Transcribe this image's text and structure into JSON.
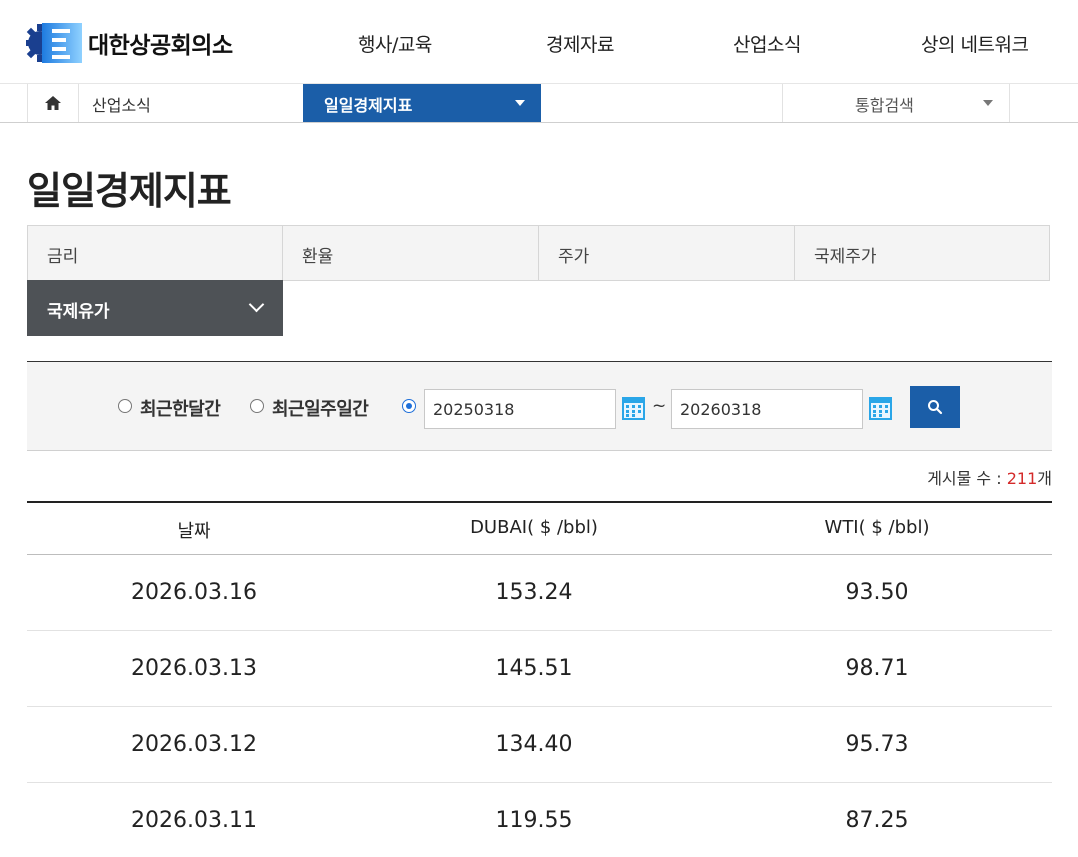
{
  "header": {
    "logo_text": "대한상공회의소",
    "nav": [
      {
        "label": "행사/교육"
      },
      {
        "label": "경제자료"
      },
      {
        "label": "산업소식"
      },
      {
        "label": "상의 네트워크"
      }
    ]
  },
  "breadcrumb": {
    "home_icon": "home-icon",
    "level1": "산업소식",
    "current": "일일경제지표",
    "search_label": "통합검색"
  },
  "page": {
    "title": "일일경제지표"
  },
  "tabs": [
    {
      "label": "금리"
    },
    {
      "label": "환율"
    },
    {
      "label": "주가"
    },
    {
      "label": "국제주가"
    },
    {
      "label": "국제유가",
      "active": true
    }
  ],
  "search": {
    "option_month": "최근한달간",
    "option_week": "최근일주일간",
    "start_date": "20250318",
    "end_date": "20260318",
    "separator": "~",
    "button_icon": "search-icon"
  },
  "count": {
    "label": "게시물 수 : ",
    "value": "211",
    "unit": "개"
  },
  "table": {
    "headers": [
      "날짜",
      "DUBAI( $ /bbl)",
      "WTI( $ /bbl)"
    ],
    "rows": [
      [
        "2026.03.16",
        "153.24",
        "93.50"
      ],
      [
        "2026.03.13",
        "145.51",
        "98.71"
      ],
      [
        "2026.03.12",
        "134.40",
        "95.73"
      ],
      [
        "2026.03.11",
        "119.55",
        "87.25"
      ]
    ]
  },
  "colors": {
    "primary": "#1b5ea8",
    "active_tab": "#4e5256",
    "count_highlight": "#d42a2a"
  }
}
